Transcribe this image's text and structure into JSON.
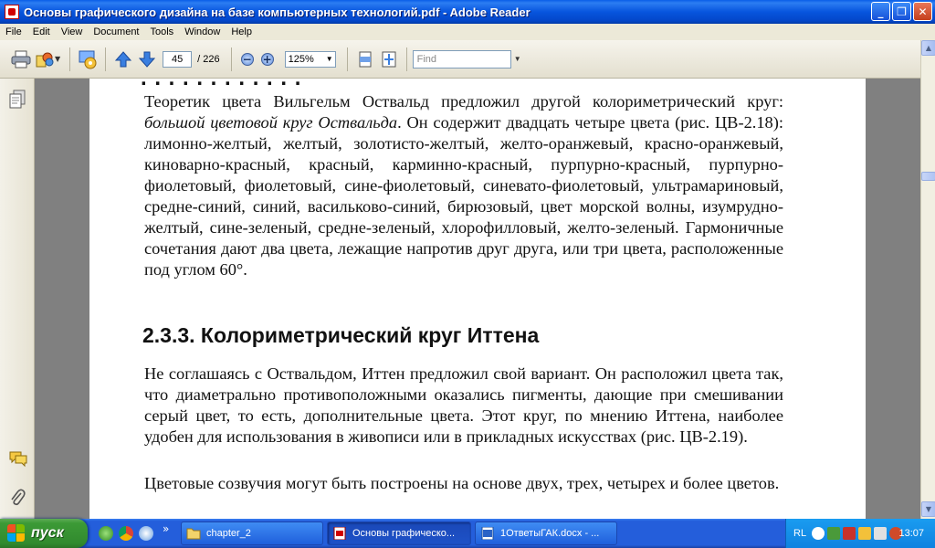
{
  "window": {
    "title": "Основы графического дизайна на базе компьютерных технологий.pdf - Adobe Reader",
    "minimize": "_",
    "maximize": "❐",
    "close": "✕"
  },
  "menu": [
    "File",
    "Edit",
    "View",
    "Document",
    "Tools",
    "Window",
    "Help"
  ],
  "toolbar": {
    "current_page": "45",
    "page_total": "/ 226",
    "zoom": "125%",
    "find_placeholder": "Find"
  },
  "document": {
    "para1_start": "Теоретик цвета Вильгельм Оствальд предложил другой колориметрический круг: ",
    "para1_italic": "большой цветовой круг Оствальда",
    "para1_rest": ". Он содержит двадцать четыре цвета (рис. ЦВ-2.18): лимонно-желтый, желтый, золотисто-желтый, желто-оранжевый, красно-оранжевый, киноварно-красный, красный, карминно-красный, пурпурно-красный, пурпурно-фиолетовый, фиолетовый, сине-фиолетовый, синевато-фиолетовый, ультрамариновый, средне-синий, синий, васильково-синий, бирюзовый, цвет морской волны, изумрудно-желтый, сине-зеленый, средне-зеленый, хлорофилловый, желто-зеленый. Гармоничные сочетания дают два цвета, лежащие напротив друг друга, или три цвета, расположенные под углом 60°.",
    "heading": "2.3.3. Колориметрический круг Иттена",
    "para2": "Не соглашаясь с Оствальдом, Иттен предложил свой вариант. Он расположил цвета так, что диаметрально противоположными оказались пигменты, дающие при смешивании серый цвет, то есть, дополнительные цвета. Этот круг, по мнению Иттена, наиболее удобен для использования в живописи или в прикладных искусствах (рис. ЦВ-2.19).",
    "para3": "Цветовые созвучия могут быть построены на основе двух, трех, четырех и более цветов."
  },
  "taskbar": {
    "start_label": "пуск",
    "chevron": "»",
    "tasks": [
      {
        "label": "chapter_2"
      },
      {
        "label": "Основы графическо..."
      },
      {
        "label": "1ОтветыГАК.docx - ..."
      }
    ],
    "language": "RL",
    "clock": "13:07"
  }
}
